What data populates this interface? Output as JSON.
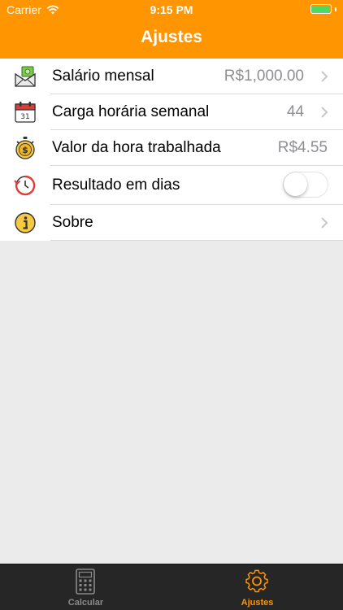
{
  "status_bar": {
    "carrier": "Carrier",
    "time": "9:15 PM",
    "battery_color": "#4cd964"
  },
  "nav": {
    "title": "Ajustes",
    "color": "#ff9500"
  },
  "settings": {
    "rows": [
      {
        "label": "Salário mensal",
        "value": "R$1,000.00",
        "icon": "money-envelope-icon",
        "disclosure": true
      },
      {
        "label": "Carga horária semanal",
        "value": "44",
        "icon": "calendar-icon",
        "disclosure": true
      },
      {
        "label": "Valor da hora trabalhada",
        "value": "R$4.55",
        "icon": "stopwatch-coin-icon",
        "disclosure": false
      },
      {
        "label": "Resultado em dias",
        "icon": "clock-history-icon",
        "toggle_on": false
      },
      {
        "label": "Sobre",
        "icon": "info-icon",
        "disclosure": true
      }
    ]
  },
  "tabbar": {
    "tabs": [
      {
        "label": "Calcular",
        "icon": "calculator-icon",
        "active": false
      },
      {
        "label": "Ajustes",
        "icon": "gear-icon",
        "active": true
      }
    ]
  }
}
